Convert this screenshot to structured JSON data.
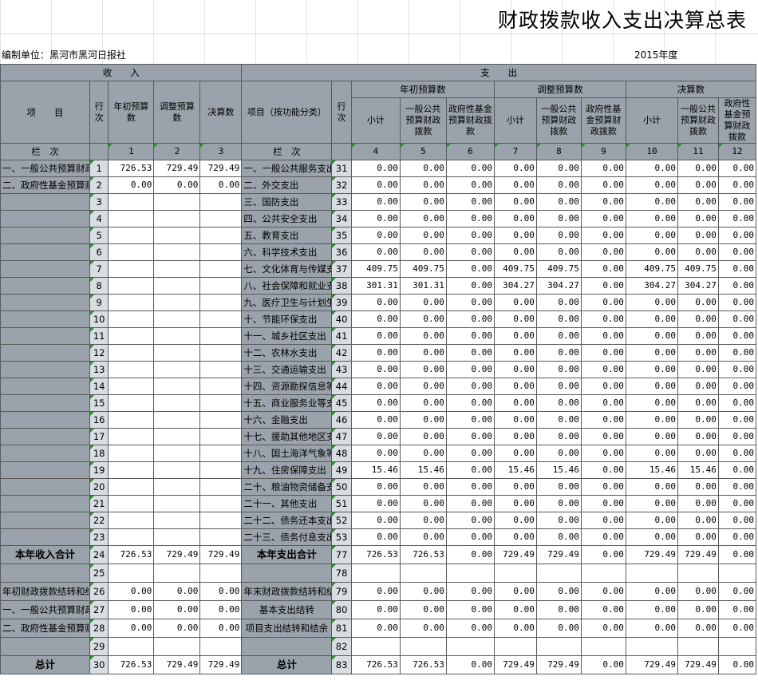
{
  "title": "财政拨款收入支出决算总表",
  "unit": "编制单位：黑河市黑河日报社",
  "year": "2015年度",
  "header": {
    "income": "收　　入",
    "expense": "支　　出",
    "item": "项　　目",
    "row_no": "行次",
    "initial_budget": "年初预算数",
    "adjusted_budget": "调整预算数",
    "final_amount": "决算数",
    "item_by_function": "项目（按功能分类）",
    "row_no2": "行次",
    "group_initial": "年初预算数",
    "group_adjusted": "调整预算数",
    "group_final": "决算数",
    "subtotal": "小计",
    "general_public": "一般公共预算财政拨款",
    "gov_fund": "政府性基金预算财政拨款",
    "column_label": "栏　次",
    "column_label2": "栏　次",
    "col_numbers": [
      "1",
      "2",
      "3",
      "4",
      "5",
      "6",
      "7",
      "8",
      "9",
      "10",
      "11",
      "12"
    ]
  },
  "rows": [
    {
      "left": "一、一般公共预算财政拨",
      "no": "1",
      "a": "726.53",
      "b": "729.49",
      "c": "729.49",
      "right": "一、一般公共服务支出",
      "no2": "31",
      "v": [
        "0.00",
        "0.00",
        "0.00",
        "0.00",
        "0.00",
        "0.00",
        "0.00",
        "0.00",
        "0.00"
      ]
    },
    {
      "left": "二、政府性基金预算财政",
      "no": "2",
      "a": "0.00",
      "b": "0.00",
      "c": "0.00",
      "right": "二、外交支出",
      "no2": "32",
      "v": [
        "0.00",
        "0.00",
        "0.00",
        "0.00",
        "0.00",
        "0.00",
        "0.00",
        "0.00",
        "0.00"
      ]
    },
    {
      "left": "",
      "no": "3",
      "a": "",
      "b": "",
      "c": "",
      "right": "三、国防支出",
      "no2": "33",
      "v": [
        "0.00",
        "0.00",
        "0.00",
        "0.00",
        "0.00",
        "0.00",
        "0.00",
        "0.00",
        "0.00"
      ]
    },
    {
      "left": "",
      "no": "4",
      "a": "",
      "b": "",
      "c": "",
      "right": "四、公共安全支出",
      "no2": "34",
      "v": [
        "0.00",
        "0.00",
        "0.00",
        "0.00",
        "0.00",
        "0.00",
        "0.00",
        "0.00",
        "0.00"
      ]
    },
    {
      "left": "",
      "no": "5",
      "a": "",
      "b": "",
      "c": "",
      "right": "五、教育支出",
      "no2": "35",
      "v": [
        "0.00",
        "0.00",
        "0.00",
        "0.00",
        "0.00",
        "0.00",
        "0.00",
        "0.00",
        "0.00"
      ]
    },
    {
      "left": "",
      "no": "6",
      "a": "",
      "b": "",
      "c": "",
      "right": "六、科学技术支出",
      "no2": "36",
      "v": [
        "0.00",
        "0.00",
        "0.00",
        "0.00",
        "0.00",
        "0.00",
        "0.00",
        "0.00",
        "0.00"
      ]
    },
    {
      "left": "",
      "no": "7",
      "a": "",
      "b": "",
      "c": "",
      "right": "七、文化体育与传媒支出",
      "no2": "37",
      "v": [
        "409.75",
        "409.75",
        "0.00",
        "409.75",
        "409.75",
        "0.00",
        "409.75",
        "409.75",
        "0.00"
      ]
    },
    {
      "left": "",
      "no": "8",
      "a": "",
      "b": "",
      "c": "",
      "right": "八、社会保障和就业支出",
      "no2": "38",
      "v": [
        "301.31",
        "301.31",
        "0.00",
        "304.27",
        "304.27",
        "0.00",
        "304.27",
        "304.27",
        "0.00"
      ]
    },
    {
      "left": "",
      "no": "9",
      "a": "",
      "b": "",
      "c": "",
      "right": "九、医疗卫生与计划生育支出",
      "no2": "39",
      "v": [
        "0.00",
        "0.00",
        "0.00",
        "0.00",
        "0.00",
        "0.00",
        "0.00",
        "0.00",
        "0.00"
      ]
    },
    {
      "left": "",
      "no": "10",
      "a": "",
      "b": "",
      "c": "",
      "right": "十、节能环保支出",
      "no2": "40",
      "v": [
        "0.00",
        "0.00",
        "0.00",
        "0.00",
        "0.00",
        "0.00",
        "0.00",
        "0.00",
        "0.00"
      ]
    },
    {
      "left": "",
      "no": "11",
      "a": "",
      "b": "",
      "c": "",
      "right": "十一、城乡社区支出",
      "no2": "41",
      "v": [
        "0.00",
        "0.00",
        "0.00",
        "0.00",
        "0.00",
        "0.00",
        "0.00",
        "0.00",
        "0.00"
      ]
    },
    {
      "left": "",
      "no": "12",
      "a": "",
      "b": "",
      "c": "",
      "right": "十二、农林水支出",
      "no2": "42",
      "v": [
        "0.00",
        "0.00",
        "0.00",
        "0.00",
        "0.00",
        "0.00",
        "0.00",
        "0.00",
        "0.00"
      ]
    },
    {
      "left": "",
      "no": "13",
      "a": "",
      "b": "",
      "c": "",
      "right": "十三、交通运输支出",
      "no2": "43",
      "v": [
        "0.00",
        "0.00",
        "0.00",
        "0.00",
        "0.00",
        "0.00",
        "0.00",
        "0.00",
        "0.00"
      ]
    },
    {
      "left": "",
      "no": "14",
      "a": "",
      "b": "",
      "c": "",
      "right": "十四、资源勘探信息等支出",
      "no2": "44",
      "v": [
        "0.00",
        "0.00",
        "0.00",
        "0.00",
        "0.00",
        "0.00",
        "0.00",
        "0.00",
        "0.00"
      ]
    },
    {
      "left": "",
      "no": "15",
      "a": "",
      "b": "",
      "c": "",
      "right": "十五、商业服务业等支出",
      "no2": "45",
      "v": [
        "0.00",
        "0.00",
        "0.00",
        "0.00",
        "0.00",
        "0.00",
        "0.00",
        "0.00",
        "0.00"
      ]
    },
    {
      "left": "",
      "no": "16",
      "a": "",
      "b": "",
      "c": "",
      "right": "十六、金融支出",
      "no2": "46",
      "v": [
        "0.00",
        "0.00",
        "0.00",
        "0.00",
        "0.00",
        "0.00",
        "0.00",
        "0.00",
        "0.00"
      ]
    },
    {
      "left": "",
      "no": "17",
      "a": "",
      "b": "",
      "c": "",
      "right": "十七、援助其他地区支出",
      "no2": "47",
      "v": [
        "0.00",
        "0.00",
        "0.00",
        "0.00",
        "0.00",
        "0.00",
        "0.00",
        "0.00",
        "0.00"
      ]
    },
    {
      "left": "",
      "no": "18",
      "a": "",
      "b": "",
      "c": "",
      "right": "十八、国土海洋气象等支出",
      "no2": "48",
      "v": [
        "0.00",
        "0.00",
        "0.00",
        "0.00",
        "0.00",
        "0.00",
        "0.00",
        "0.00",
        "0.00"
      ]
    },
    {
      "left": "",
      "no": "19",
      "a": "",
      "b": "",
      "c": "",
      "right": "十九、住房保障支出",
      "no2": "49",
      "v": [
        "15.46",
        "15.46",
        "0.00",
        "15.46",
        "15.46",
        "0.00",
        "15.46",
        "15.46",
        "0.00"
      ]
    },
    {
      "left": "",
      "no": "20",
      "a": "",
      "b": "",
      "c": "",
      "right": "二十、粮油物资储备支出",
      "no2": "50",
      "v": [
        "0.00",
        "0.00",
        "0.00",
        "0.00",
        "0.00",
        "0.00",
        "0.00",
        "0.00",
        "0.00"
      ]
    },
    {
      "left": "",
      "no": "21",
      "a": "",
      "b": "",
      "c": "",
      "right": "二十一、其他支出",
      "no2": "51",
      "v": [
        "0.00",
        "0.00",
        "0.00",
        "0.00",
        "0.00",
        "0.00",
        "0.00",
        "0.00",
        "0.00"
      ]
    },
    {
      "left": "",
      "no": "22",
      "a": "",
      "b": "",
      "c": "",
      "right": "二十二、债务还本支出",
      "no2": "52",
      "v": [
        "0.00",
        "0.00",
        "0.00",
        "0.00",
        "0.00",
        "0.00",
        "0.00",
        "0.00",
        "0.00"
      ]
    },
    {
      "left": "",
      "no": "23",
      "a": "",
      "b": "",
      "c": "",
      "right": "二十三、债务付息支出",
      "no2": "53",
      "v": [
        "0.00",
        "0.00",
        "0.00",
        "0.00",
        "0.00",
        "0.00",
        "0.00",
        "0.00",
        "0.00"
      ]
    }
  ],
  "summary": [
    {
      "left": "本年收入合计",
      "no": "24",
      "a": "726.53",
      "b": "729.49",
      "c": "729.49",
      "right": "本年支出合计",
      "no2": "77",
      "v": [
        "726.53",
        "726.53",
        "0.00",
        "729.49",
        "729.49",
        "0.00",
        "729.49",
        "729.49",
        "0.00"
      ],
      "bold": true
    },
    {
      "left": "",
      "no": "25",
      "a": "",
      "b": "",
      "c": "",
      "right": "",
      "no2": "78",
      "v": [
        "",
        "",
        "",
        "",
        "",
        "",
        "",
        "",
        ""
      ]
    },
    {
      "left": "年初财政拨款结转和结余",
      "no": "26",
      "a": "0.00",
      "b": "0.00",
      "c": "0.00",
      "right": "年末财政拨款结转和结余",
      "no2": "79",
      "v": [
        "0.00",
        "0.00",
        "0.00",
        "0.00",
        "0.00",
        "0.00",
        "0.00",
        "0.00",
        "0.00"
      ]
    },
    {
      "left": "一、一般公共预算财政拨",
      "no": "27",
      "a": "0.00",
      "b": "0.00",
      "c": "0.00",
      "right": "基本支出结转",
      "no2": "80",
      "v": [
        "0.00",
        "0.00",
        "0.00",
        "0.00",
        "0.00",
        "0.00",
        "0.00",
        "0.00",
        "0.00"
      ]
    },
    {
      "left": "二、政府性基金预算财政",
      "no": "28",
      "a": "0.00",
      "b": "0.00",
      "c": "0.00",
      "right": "项目支出结转和结余",
      "no2": "81",
      "v": [
        "0.00",
        "0.00",
        "0.00",
        "0.00",
        "0.00",
        "0.00",
        "0.00",
        "0.00",
        "0.00"
      ]
    },
    {
      "left": "",
      "no": "29",
      "a": "",
      "b": "",
      "c": "",
      "right": "",
      "no2": "82",
      "v": [
        "",
        "",
        "",
        "",
        "",
        "",
        "",
        "",
        ""
      ]
    },
    {
      "left": "总计",
      "no": "30",
      "a": "726.53",
      "b": "729.49",
      "c": "729.49",
      "right": "总计",
      "no2": "83",
      "v": [
        "726.53",
        "726.53",
        "0.00",
        "729.49",
        "729.49",
        "0.00",
        "729.49",
        "729.49",
        "0.00"
      ],
      "bold": true
    }
  ]
}
